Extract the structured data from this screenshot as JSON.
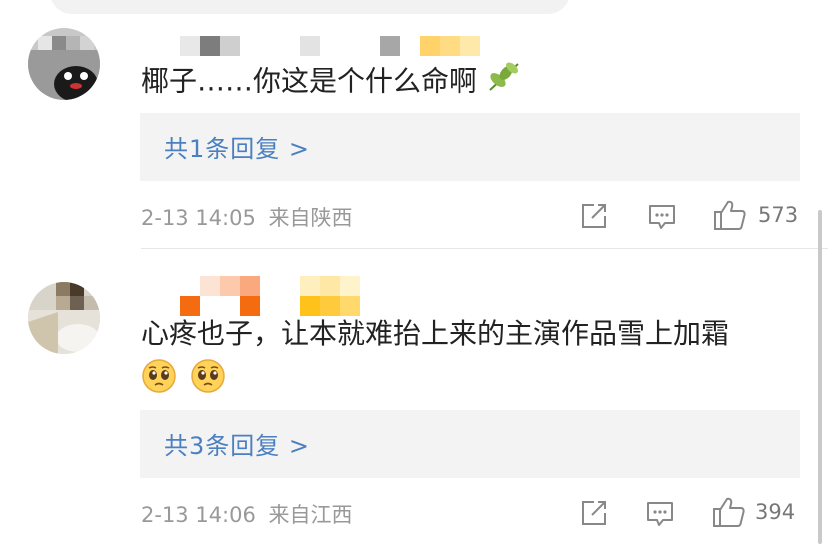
{
  "comments": [
    {
      "text": "椰子……你这是个什么命啊",
      "emoji": "leaf-emoji",
      "reply_label": "共1条回复 >",
      "time": "2-13 14:05",
      "location": "来自陕西",
      "likes": "573"
    },
    {
      "text": "心疼也子，让本就难抬上来的主演作品雪上加霜",
      "emoji": "pleading-face-emoji",
      "reply_label": "共3条回复 >",
      "time": "2-13 14:06",
      "location": "来自江西",
      "likes": "394"
    }
  ],
  "colors": {
    "reply_link": "#4a7fc0",
    "meta": "#999999",
    "reply_bg": "#f3f3f3"
  }
}
